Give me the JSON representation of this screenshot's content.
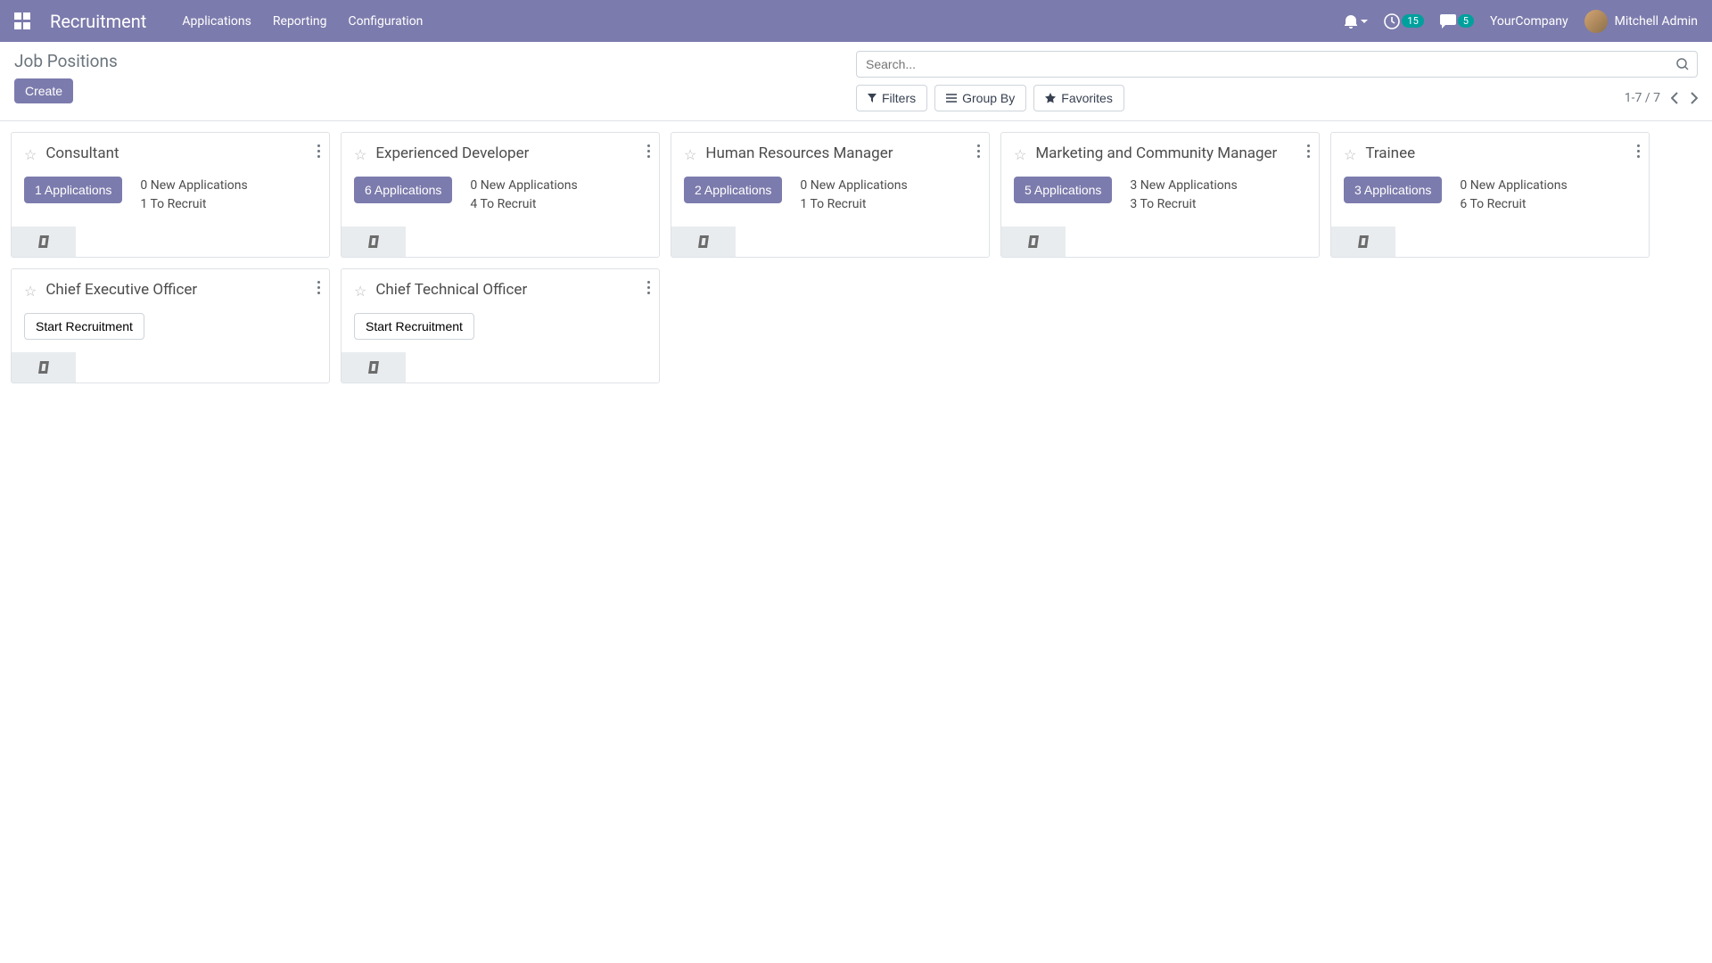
{
  "navbar": {
    "app_title": "Recruitment",
    "menu": [
      "Applications",
      "Reporting",
      "Configuration"
    ],
    "activity_badge": "15",
    "messages_badge": "5",
    "company": "YourCompany",
    "user": "Mitchell Admin"
  },
  "control": {
    "breadcrumb": "Job Positions",
    "create": "Create",
    "search_placeholder": "Search...",
    "filters": "Filters",
    "group_by": "Group By",
    "favorites": "Favorites",
    "pager": "1-7 / 7"
  },
  "cards": [
    {
      "title": "Consultant",
      "apps_btn": "1 Applications",
      "line1": "0 New Applications",
      "line2": "1 To Recruit",
      "start": "",
      "footer": true
    },
    {
      "title": "Experienced Developer",
      "apps_btn": "6 Applications",
      "line1": "0 New Applications",
      "line2": "4 To Recruit",
      "start": "",
      "footer": true
    },
    {
      "title": "Human Resources Manager",
      "apps_btn": "2 Applications",
      "line1": "0 New Applications",
      "line2": "1 To Recruit",
      "start": "",
      "footer": true
    },
    {
      "title": "Marketing and Community Manager",
      "apps_btn": "5 Applications",
      "line1": "3 New Applications",
      "line2": "3 To Recruit",
      "start": "",
      "footer": true
    },
    {
      "title": "Trainee",
      "apps_btn": "3 Applications",
      "line1": "0 New Applications",
      "line2": "6 To Recruit",
      "start": "",
      "footer": true
    },
    {
      "title": "Chief Executive Officer",
      "apps_btn": "",
      "line1": "",
      "line2": "",
      "start": "Start Recruitment",
      "footer": true
    },
    {
      "title": "Chief Technical Officer",
      "apps_btn": "",
      "line1": "",
      "line2": "",
      "start": "Start Recruitment",
      "footer": true
    }
  ]
}
